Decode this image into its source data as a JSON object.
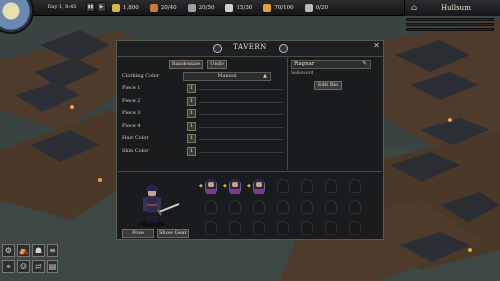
{
  "colors": {
    "water": "#36403f",
    "deck": "#5a4330",
    "roof": "#2a2e33",
    "panel": "#16191b",
    "accent_gold": "#e0a040",
    "recruit_shirt": "#7a3c8a"
  },
  "hud": {
    "day_label": "Day 1, 8:45",
    "resources": [
      {
        "icon": "coins-icon",
        "value": "1,800",
        "color": "#d8b24a"
      },
      {
        "icon": "food-icon",
        "value": "20/40",
        "color": "#c77a3a"
      },
      {
        "icon": "supplies-icon",
        "value": "20/50",
        "color": "#9aa0a6"
      },
      {
        "icon": "medicine-icon",
        "value": "15/30",
        "color": "#cfcfcf"
      },
      {
        "icon": "torch-icon",
        "value": "70/100",
        "color": "#e0a040"
      },
      {
        "icon": "crew-icon",
        "value": "0/20",
        "color": "#b8b8b8"
      }
    ],
    "town_name": "Hullsum"
  },
  "tavern": {
    "title": "TAVERN",
    "randomize_label": "Randomize",
    "undo_label": "Undo",
    "clothing_color_label": "Clothing Color",
    "clothing_color_value": "Manual",
    "rows": [
      {
        "label": "Piece 1",
        "value": "1"
      },
      {
        "label": "Piece 2",
        "value": "1"
      },
      {
        "label": "Piece 3",
        "value": "1"
      },
      {
        "label": "Piece 4",
        "value": "1"
      },
      {
        "label": "Hair Color",
        "value": "1"
      },
      {
        "label": "Skin Color",
        "value": "1"
      }
    ],
    "character_name": "Ragnar",
    "character_class": "Sellsword",
    "edit_bio_label": "Edit Bio",
    "pose_label": "Pose",
    "show_gear_label": "Show Gear",
    "recruits_filled": 3,
    "recruit_slots": 21
  }
}
